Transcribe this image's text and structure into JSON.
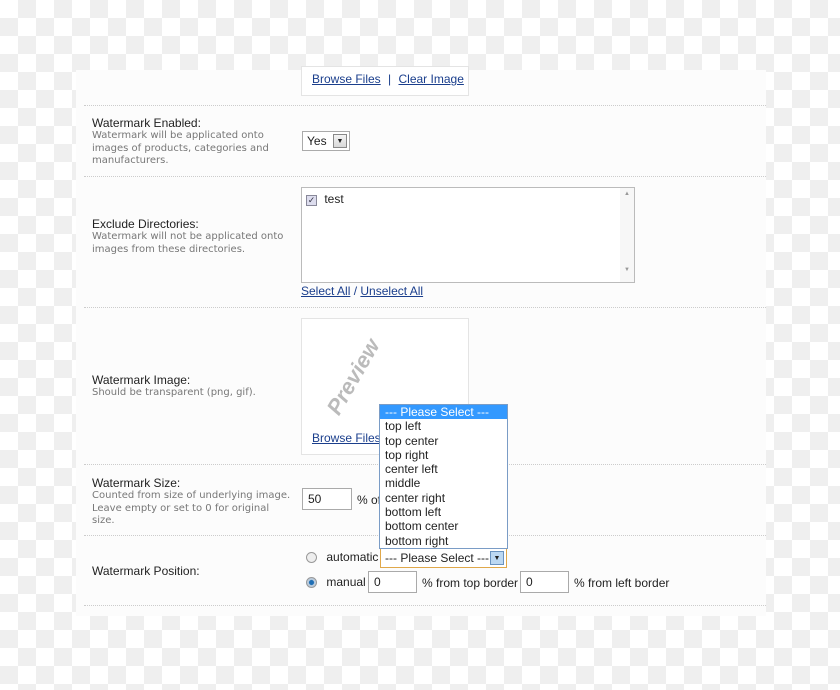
{
  "top_links": {
    "browse": "Browse Files",
    "sep": "|",
    "clear": "Clear Image"
  },
  "enabled": {
    "title": "Watermark Enabled:",
    "desc": "Watermark will be applicated onto images of products, categories and manufacturers.",
    "value": "Yes"
  },
  "exclude": {
    "title": "Exclude Directories:",
    "desc": "Watermark will not be applicated onto images from these directories.",
    "items": [
      {
        "label": "test",
        "checked": true
      }
    ],
    "select_all": "Select All",
    "sep": "/",
    "unselect_all": "Unselect All"
  },
  "image": {
    "title": "Watermark Image:",
    "desc": "Should be transparent (png, gif).",
    "preview_text": "Preview",
    "browse": "Browse Files"
  },
  "size": {
    "title": "Watermark Size:",
    "desc": "Counted from size of underlying image. Leave empty or set to 0 for original size.",
    "value": "50",
    "suffix": "% of"
  },
  "position": {
    "title": "Watermark Position:",
    "automatic": "automatic",
    "manual": "manual",
    "selected_mode": "manual",
    "select_value": "--- Please Select ---",
    "top_value": "0",
    "top_suffix": "% from top border",
    "left_value": "0",
    "left_suffix": "% from left border",
    "options": [
      "--- Please Select ---",
      "top left",
      "top center",
      "top right",
      "center left",
      "middle",
      "center right",
      "bottom left",
      "bottom center",
      "bottom right"
    ]
  }
}
